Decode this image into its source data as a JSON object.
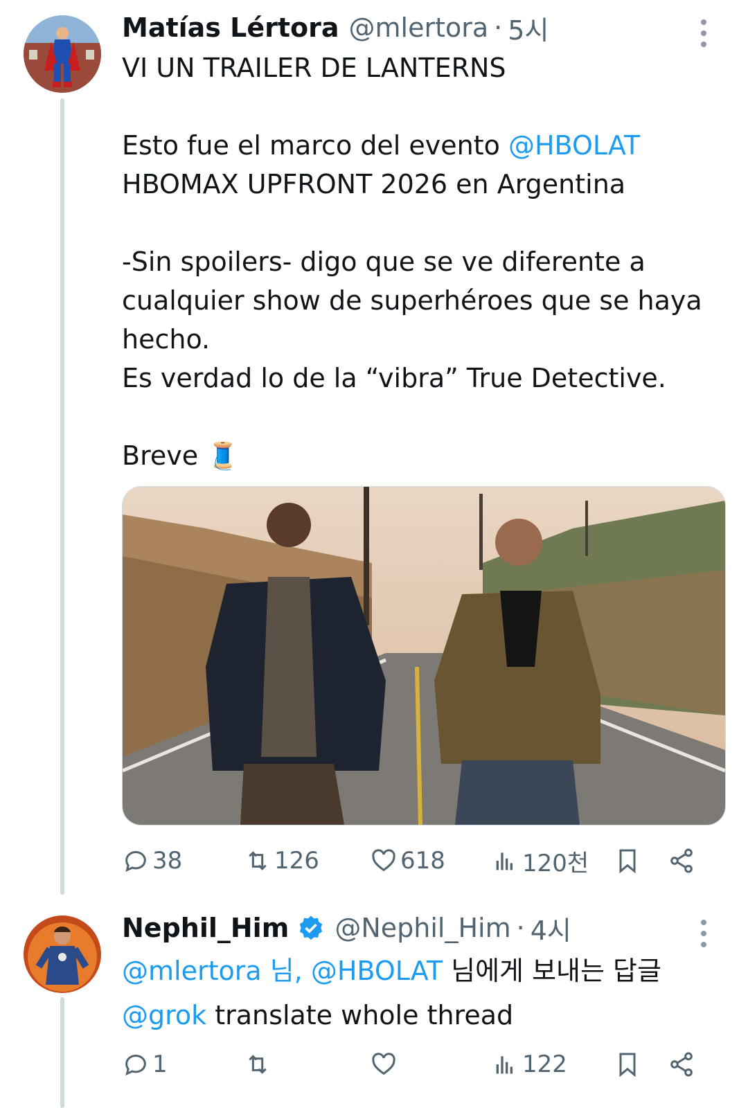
{
  "tweets": [
    {
      "author": "Matías Lértora",
      "handle": "@mlertora",
      "dot": "·",
      "time": "5시",
      "lines": {
        "l1": "VI UN TRAILER DE LANTERNS",
        "l2a": "Esto fue el marco del evento ",
        "l2_mention": "@HBOLAT",
        "l3": "HBOMAX UPFRONT 2026 en Argentina",
        "l4": "-Sin spoilers- digo que se ve diferente a cualquier show de superhéroes que se haya hecho.",
        "l5": "Es verdad lo de la “vibra” True Detective.",
        "l6": "Breve 🧵"
      },
      "stats": {
        "replies": "38",
        "reposts": "126",
        "likes": "618",
        "views": "120천"
      }
    },
    {
      "author": "Nephil_Him",
      "handle": "@Nephil_Him",
      "dot": "·",
      "time": "4시",
      "reply_to": {
        "m1": "@mlertora",
        "w1": " 님,",
        "m2": " @HBOLAT",
        "w2": " 님에게 보내는 답글"
      },
      "text_mention": "@grok",
      "text": " translate whole thread",
      "stats": {
        "replies": "1",
        "reposts": "",
        "likes": "",
        "views": "122"
      }
    }
  ],
  "colors": {
    "accent": "#1d9bf0",
    "muted": "#536471",
    "thread_line": "#cfd9de"
  },
  "icons": [
    "reply-icon",
    "repost-icon",
    "like-icon",
    "views-icon",
    "bookmark-icon",
    "share-icon",
    "more-icon",
    "verified-badge-icon"
  ]
}
